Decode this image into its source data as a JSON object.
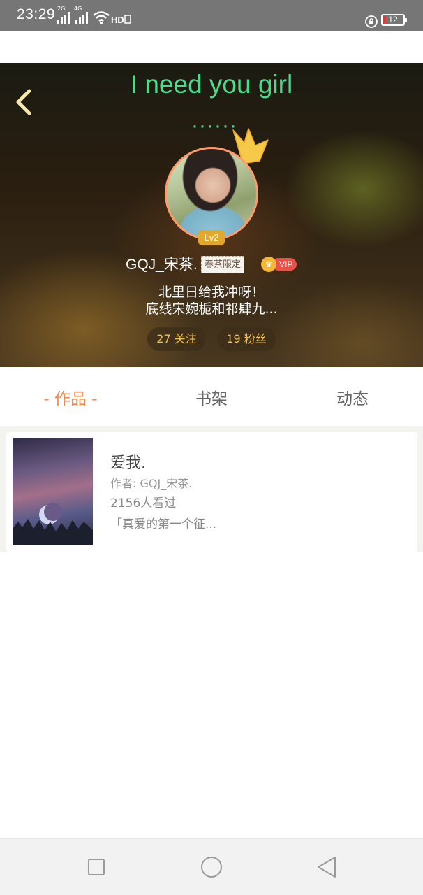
{
  "status_bar": {
    "time": "23:29",
    "signal_1": "2G",
    "signal_2": "4G",
    "battery": "12"
  },
  "hero": {
    "title": "I need you girl",
    "dots": "······",
    "level": "Lv2",
    "username": "GQJ_宋茶.",
    "tag": "春茶限定",
    "vip_label": "VIP",
    "bio_line1": "北里日给我冲呀！",
    "bio_line2": "底线宋婉栀和祁肆九...",
    "following": "27 关注",
    "followers": "19 粉丝"
  },
  "tabs": [
    {
      "label": "- 作品 -",
      "active": true
    },
    {
      "label": "书架",
      "active": false
    },
    {
      "label": "动态",
      "active": false
    }
  ],
  "works": [
    {
      "title": "爱我.",
      "author": "作者: GQJ_宋茶.",
      "views": "2156人看过",
      "desc": "「真爱的第一个征..."
    }
  ],
  "colors": {
    "accent": "#f08a4b",
    "title_green": "#4fd98a",
    "stat_text": "#f0c04a",
    "vip_red": "#e8524a",
    "level_gold": "#e0a92e"
  },
  "icons": {
    "back": "chevron-left-icon",
    "crown": "crown-icon",
    "nav_recents": "square-icon",
    "nav_home": "circle-icon",
    "nav_back": "triangle-back-icon"
  }
}
